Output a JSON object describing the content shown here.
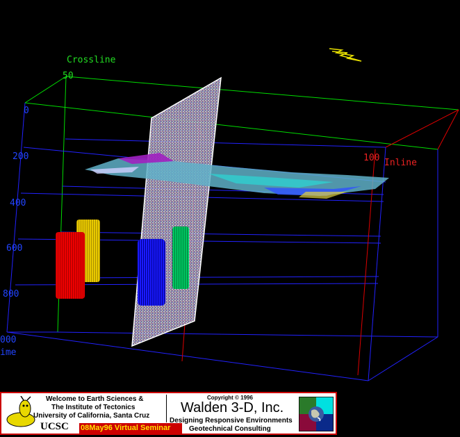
{
  "axes": {
    "crossline_label": "Crossline",
    "crossline_tick": "50",
    "inline_label": "Inline",
    "inline_tick": "100",
    "time_label": "ime",
    "time_ticks": [
      "0",
      "200",
      "400",
      "600",
      "800",
      "000"
    ]
  },
  "colors": {
    "cube_green": "#00dd00",
    "cube_blue": "#2222ff",
    "inline_red": "#dd0000",
    "tick_blue": "#2244ff",
    "label_green": "#22dd22",
    "label_red": "#ee2222"
  },
  "banner": {
    "welcome_line1": "Welcome to Earth Sciences &",
    "welcome_line2": "The Institute of Tectonics",
    "welcome_line3": "University of California, Santa Cruz",
    "ucsc": "UCSC",
    "seminar": "08May96 Virtual Seminar",
    "copyright": "Copyright © 1996",
    "company": "Walden 3-D, Inc.",
    "tagline1": "Designing Responsive Environments",
    "tagline2": "Geotechnical Consulting"
  }
}
